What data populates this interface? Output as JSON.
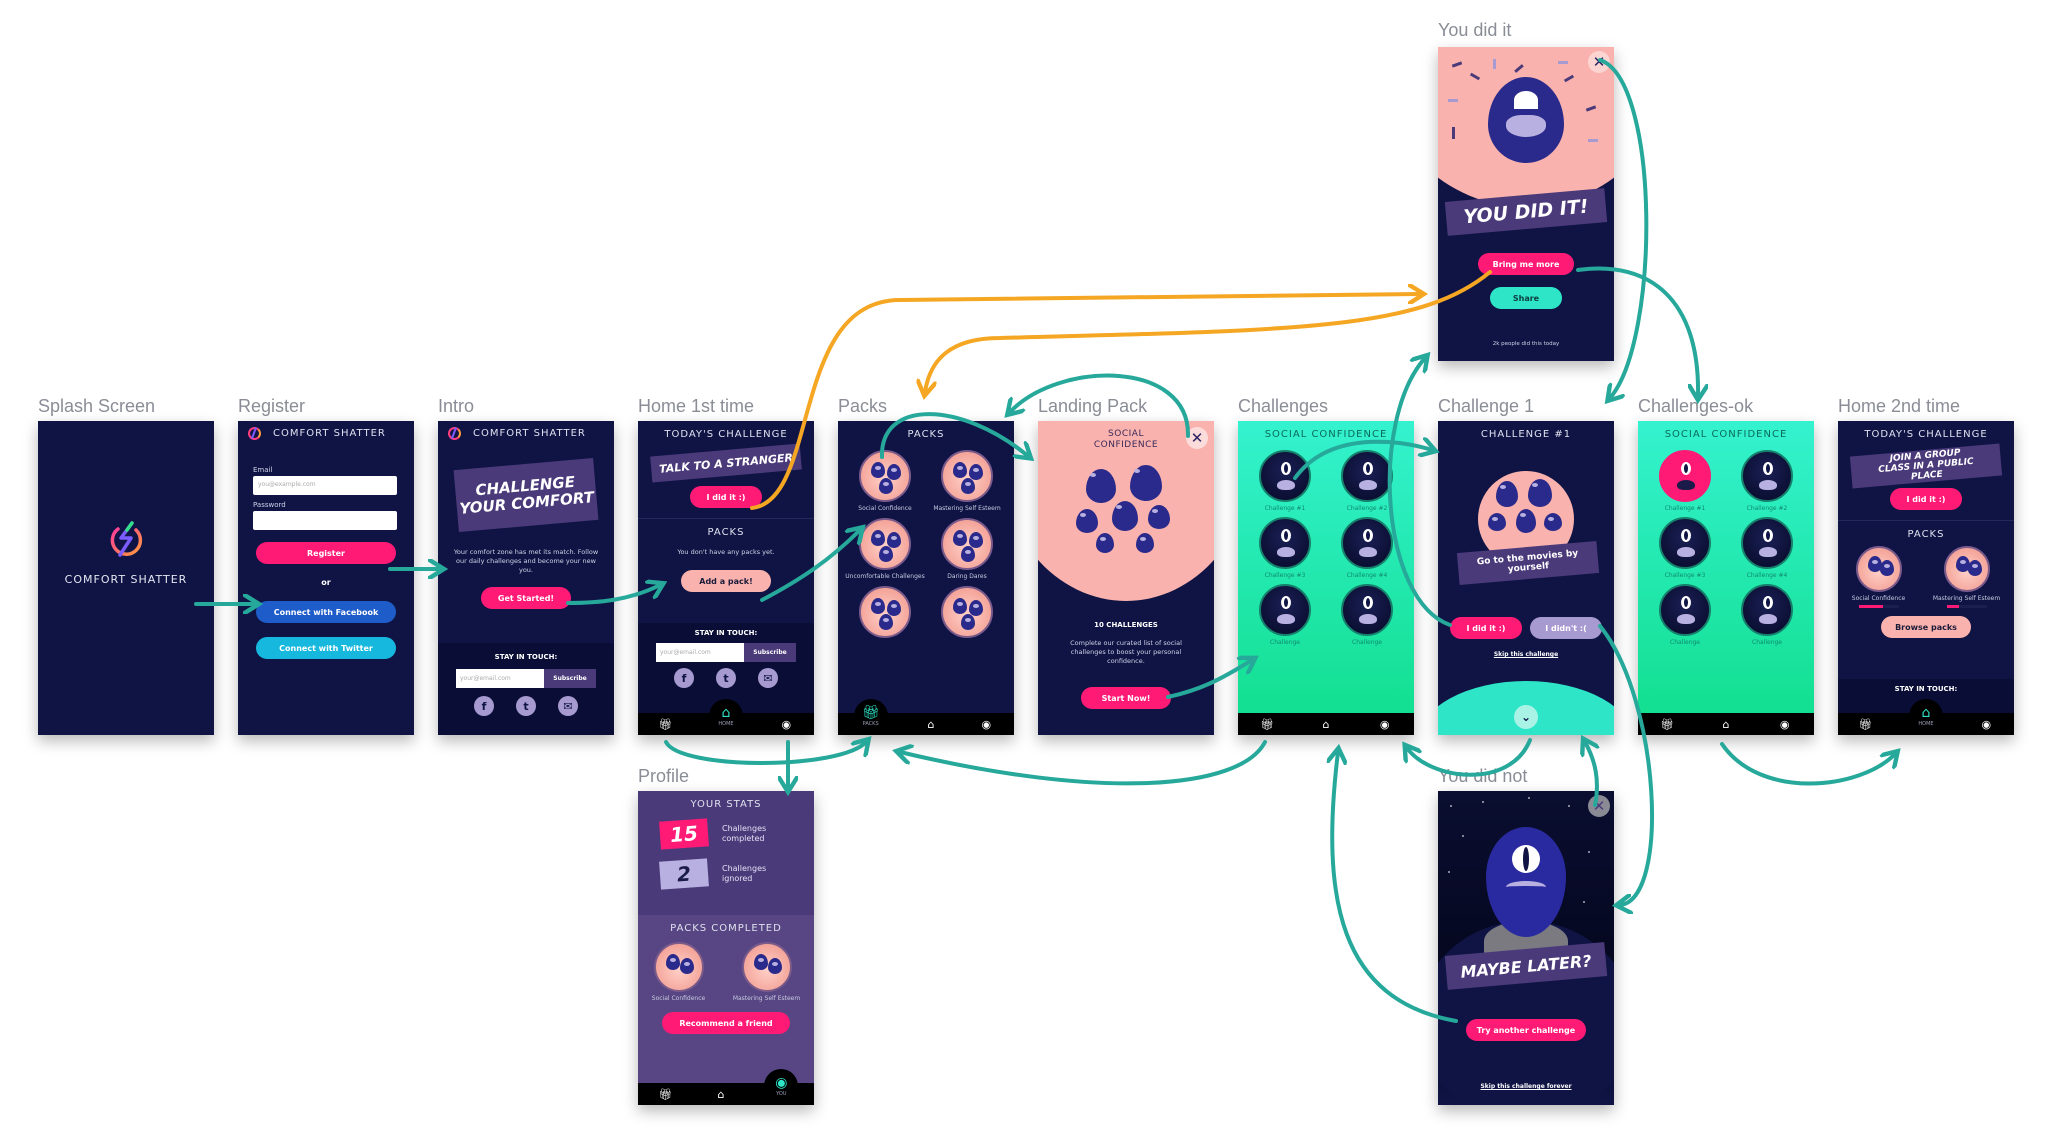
{
  "colors": {
    "navy": "#0f1445",
    "pink": "#ff1a75",
    "peach": "#f9b2ad",
    "teal_arrow": "#26a89a",
    "orange_arrow": "#f5a623",
    "mint": "#2ee6c7",
    "purple_brush": "#4b3a7a"
  },
  "app_name": "COMFORT SHATTER",
  "screens": {
    "splash": {
      "label": "Splash Screen",
      "brand": "COMFORT SHATTER"
    },
    "register": {
      "label": "Register",
      "brand": "COMFORT SHATTER",
      "email_label": "Email",
      "email_placeholder": "you@example.com",
      "password_label": "Password",
      "register_button": "Register",
      "or_text": "or",
      "facebook_button": "Connect with Facebook",
      "twitter_button": "Connect with Twitter"
    },
    "intro": {
      "label": "Intro",
      "brand": "COMFORT SHATTER",
      "headline_line1": "CHALLENGE",
      "headline_line2": "YOUR COMFORT",
      "body": "Your comfort zone has met its match. Follow our daily challenges and become your new you.",
      "cta": "Get Started!",
      "stay_in_touch": "STAY IN TOUCH:",
      "email_placeholder": "your@email.com",
      "subscribe": "Subscribe"
    },
    "home1": {
      "label": "Home 1st time",
      "title": "TODAY'S  CHALLENGE",
      "challenge": "TALK TO A STRANGER",
      "did_it": "I did it :)",
      "packs_title": "PACKS",
      "no_packs": "You don't have any packs yet.",
      "add_pack": "Add a pack!",
      "stay_in_touch": "STAY IN TOUCH:",
      "email_placeholder": "your@email.com",
      "subscribe": "Subscribe",
      "tab_home": "HOME"
    },
    "packs": {
      "label": "Packs",
      "title": "PACKS",
      "items": [
        {
          "name": "Social Confidence"
        },
        {
          "name": "Mastering Self Esteem"
        },
        {
          "name": "Uncomfortable Challenges"
        },
        {
          "name": "Daring Dares"
        },
        {
          "name": ""
        },
        {
          "name": ""
        }
      ],
      "tab_packs": "PACKS"
    },
    "landing": {
      "label": "Landing Pack",
      "title_line1": "SOCIAL",
      "title_line2": "CONFIDENCE",
      "count": "10 CHALLENGES",
      "description": "Complete our curated list of social challenges to boost your personal confidence.",
      "cta": "Start Now!"
    },
    "challenges": {
      "label": "Challenges",
      "title": "SOCIAL CONFIDENCE",
      "items": [
        {
          "name": "Challenge #1"
        },
        {
          "name": "Challenge #2"
        },
        {
          "name": "Challenge #3"
        },
        {
          "name": "Challenge #4"
        },
        {
          "name": "Challenge"
        },
        {
          "name": "Challenge"
        }
      ]
    },
    "challenge1": {
      "label": "Challenge 1",
      "title": "CHALLENGE #1",
      "task": "Go to the movies by yourself",
      "did_it": "I did it :)",
      "didnt": "I didn't :(",
      "skip": "Skip this challenge"
    },
    "challenges_ok": {
      "label": "Challenges-ok",
      "title": "SOCIAL CONFIDENCE",
      "items": [
        {
          "name": "Challenge #1",
          "done": true
        },
        {
          "name": "Challenge #2",
          "done": false
        },
        {
          "name": "Challenge #3",
          "done": false
        },
        {
          "name": "Challenge #4",
          "done": false
        },
        {
          "name": "Challenge",
          "done": false
        },
        {
          "name": "Challenge",
          "done": false
        }
      ]
    },
    "home2": {
      "label": "Home 2nd time",
      "title": "TODAY'S  CHALLENGE",
      "challenge": "JOIN A GROUP CLASS IN A PUBLIC PLACE",
      "did_it": "I did it :)",
      "packs_title": "PACKS",
      "packs": [
        {
          "name": "Social Confidence",
          "progress": 0.6
        },
        {
          "name": "Mastering Self Esteem",
          "progress": 0.3
        }
      ],
      "browse": "Browse packs",
      "stay_in_touch": "STAY IN TOUCH:",
      "tab_home": "HOME"
    },
    "you_did_it": {
      "label": "You did it",
      "headline": "YOU DID IT!",
      "more": "Bring me more",
      "share": "Share",
      "footnote": "2k people did this today"
    },
    "you_did_not": {
      "label": "You did not",
      "headline": "MAYBE LATER?",
      "cta": "Try another challenge",
      "skip": "Skip this challenge forever"
    },
    "profile": {
      "label": "Profile",
      "stats_title": "YOUR STATS",
      "completed_count": "15",
      "completed_label": "Challenges completed",
      "ignored_count": "2",
      "ignored_label": "Challenges ignored",
      "packs_title": "PACKS COMPLETED",
      "packs": [
        {
          "name": "Social Confidence"
        },
        {
          "name": "Mastering Self Esteem"
        }
      ],
      "recommend": "Recommend a friend",
      "tab_you": "YOU"
    }
  }
}
